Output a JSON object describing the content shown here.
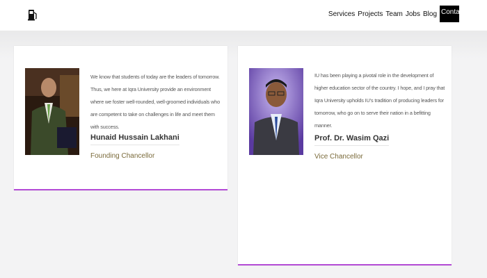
{
  "header": {
    "logo_icon": "fuel-pump-icon",
    "nav": [
      {
        "label": "Services"
      },
      {
        "label": "Projects"
      },
      {
        "label": "Team"
      },
      {
        "label": "Jobs"
      },
      {
        "label": "Blog"
      },
      {
        "label": "Contac"
      }
    ]
  },
  "cards": [
    {
      "quote": "We know that students of today are the leaders of tomorrow. Thus, we here at Iqra University provide an environment where we foster well-rounded, well-groomed individuals who are competent to take on challenges in life and meet them with success.",
      "name": "Hunaid Hussain Lakhani",
      "title": "Founding Chancellor"
    },
    {
      "quote": "IU has been playing a pivotal role in the development of higher education sector of the country. I hope, and I pray that Iqra University upholds IU’s tradition of producing leaders for tomorrow, who go on to serve their nation in a befitting manner.",
      "name": "Prof. Dr. Wasim Qazi",
      "title": "Vice Chancellor"
    }
  ],
  "colors": {
    "accent": "#b44bd6",
    "title_text": "#7a6a3a"
  }
}
